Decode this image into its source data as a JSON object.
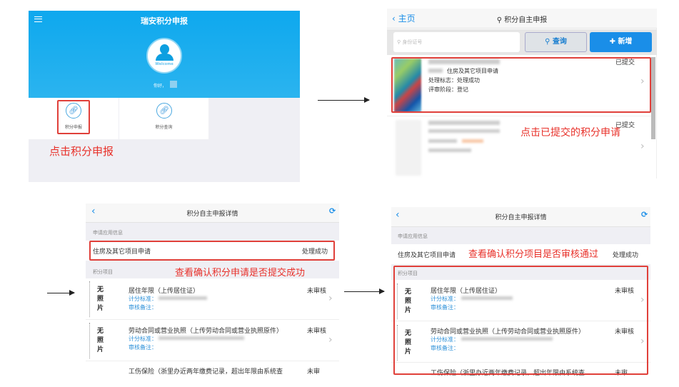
{
  "panel1": {
    "title": "瑞安积分申报",
    "welcome": "Welcome",
    "greeting": "你好，",
    "tiles": [
      {
        "label": "积分申报"
      },
      {
        "label": "积分查询"
      }
    ],
    "annotation": "点击积分申报"
  },
  "panel2": {
    "back": "主页",
    "title": "积分自主申报",
    "search_placeholder": "身份证号",
    "query_button": "查询",
    "add_button": "新增",
    "items": [
      {
        "status": "已提交",
        "type": "住房及其它项目申请",
        "flag": "处理标志：处理成功",
        "stage": "评审阶段：登记"
      },
      {
        "status": "已提交"
      }
    ],
    "annotation": "点击已提交的积分申请"
  },
  "detail": {
    "title": "积分自主申报详情",
    "section_info": "申请应用信息",
    "application": "住房及其它项目申请",
    "application_status": "处理成功",
    "section_items": "积分项目",
    "no_photo": [
      "无",
      "照",
      "片"
    ],
    "std_label": "计分标准：",
    "note_label": "审核备注：",
    "items": [
      {
        "name": "居住年限（上传居住证）",
        "status": "未审核"
      },
      {
        "name": "劳动合同或营业执照（上传劳动合同或营业执照原件）",
        "status": "未审核"
      },
      {
        "name": "工伤保险（浙里办近两年缴费记录，超出年限由系统查",
        "status": "未审"
      }
    ]
  },
  "panel3": {
    "annotation": "查看确认积分申请是否提交成功"
  },
  "panel4": {
    "annotation": "查看确认积分项目是否审核通过"
  },
  "colors": {
    "accent": "#1a8ee8",
    "header_blue": "#0fa8ec",
    "annotation": "#e8312a"
  }
}
